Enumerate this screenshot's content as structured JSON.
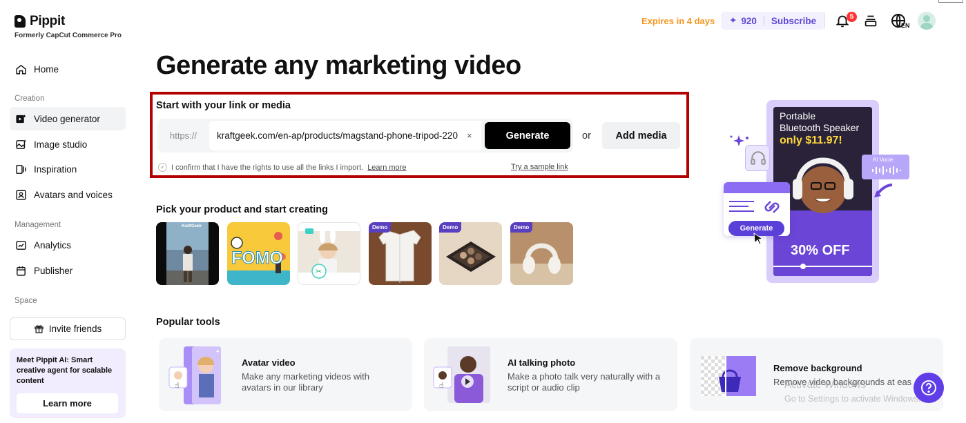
{
  "brand": {
    "name": "Pippit",
    "subtitle": "Formerly CapCut Commerce Pro"
  },
  "sidebar": {
    "home": "Home",
    "sections": {
      "creation": "Creation",
      "management": "Management",
      "space": "Space"
    },
    "creation_items": [
      "Video generator",
      "Image studio",
      "Inspiration",
      "Avatars and voices"
    ],
    "management_items": [
      "Analytics",
      "Publisher"
    ],
    "invite_label": "Invite friends",
    "meet_text": "Meet Pippit AI: Smart creative agent for scalable content",
    "learn_more": "Learn more"
  },
  "header": {
    "expires": "Expires in 4 days",
    "credits": "920",
    "subscribe": "Subscribe",
    "notification_count": "5",
    "language": "EN"
  },
  "main": {
    "title": "Generate any marketing video",
    "start_label": "Start with your link or media",
    "url_prefix": "https://",
    "url_value": "kraftgeek.com/en-ap/products/magstand-phone-tripod-220",
    "clear_symbol": "×",
    "generate_label": "Generate",
    "or_text": "or",
    "add_media_label": "Add media",
    "confirm_text": "I confirm that I have the rights to use all the links I import.",
    "confirm_link": "Learn more",
    "sample_link": "Try a sample link",
    "pick_title": "Pick your product and start creating",
    "thumbnails": [
      {
        "tag": "",
        "caption": "KraftGeek"
      },
      {
        "tag": "",
        "caption": "FOMO"
      },
      {
        "tag": "",
        "caption": ""
      },
      {
        "tag": "Demo",
        "caption": ""
      },
      {
        "tag": "Demo",
        "caption": ""
      },
      {
        "tag": "Demo",
        "caption": ""
      }
    ],
    "tools_title": "Popular tools",
    "tools": [
      {
        "name": "Avatar video",
        "desc": "Make any marketing videos with avatars in our library"
      },
      {
        "name": "AI talking photo",
        "desc": "Make a photo talk very naturally with a script or audio clip"
      },
      {
        "name": "Remove background",
        "desc": "Remove video backgrounds at eas"
      }
    ]
  },
  "promo": {
    "line1": "Portable",
    "line2": "Bluetooth Speaker",
    "price": "only $11.97!",
    "ai_voice": "AI Vocie",
    "generate": "Generate",
    "discount": "30% OFF"
  },
  "watermark": {
    "line1": "Activate Windows",
    "line2": "Go to Settings to activate Windows."
  },
  "colors": {
    "accent": "#5b47d6",
    "expires": "#f5951d",
    "highlight_border": "#b30000",
    "help_button": "#5f3ee8"
  }
}
